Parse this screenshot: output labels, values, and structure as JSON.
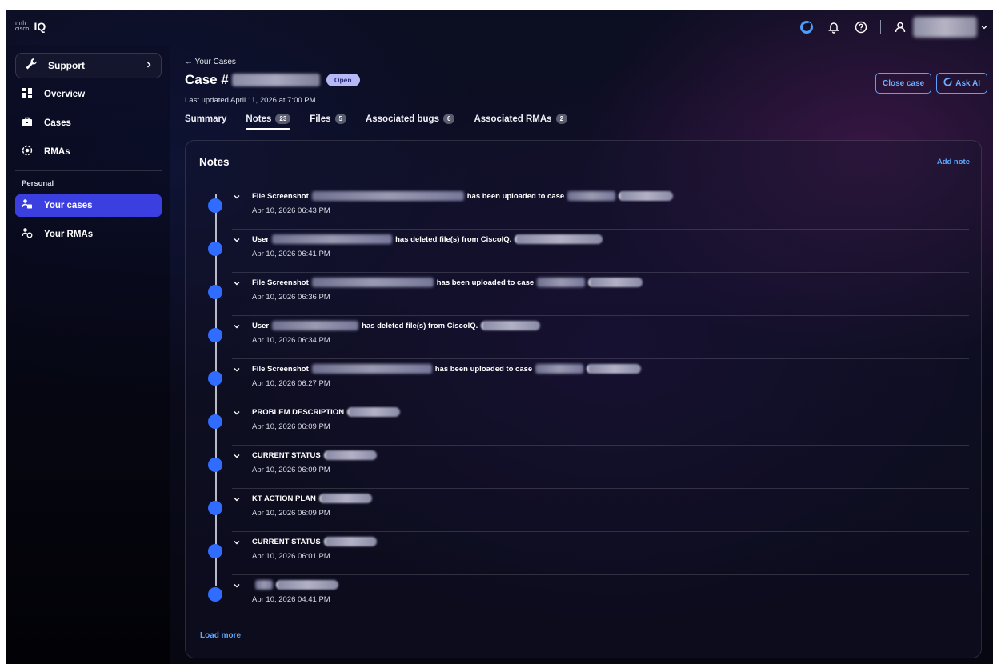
{
  "app": {
    "logo_small": "cisco",
    "logo_text": "IQ"
  },
  "sidebar": {
    "support_label": "Support",
    "items": [
      {
        "label": "Overview",
        "icon": "overview-icon"
      },
      {
        "label": "Cases",
        "icon": "briefcase-icon"
      },
      {
        "label": "RMAs",
        "icon": "rma-icon"
      }
    ],
    "personal_label": "Personal",
    "personal_items": [
      {
        "label": "Your cases",
        "icon": "user-case-icon",
        "active": true
      },
      {
        "label": "Your RMAs",
        "icon": "user-rma-icon",
        "active": false
      }
    ]
  },
  "header": {
    "back_label": "← Your Cases",
    "case_prefix": "Case #",
    "status": "Open",
    "updated": "Last updated April 11, 2026 at 7:00 PM",
    "close_case_label": "Close case",
    "ask_ai_label": "Ask AI"
  },
  "tabs": [
    {
      "label": "Summary",
      "count": ""
    },
    {
      "label": "Notes",
      "count": "23"
    },
    {
      "label": "Files",
      "count": "5"
    },
    {
      "label": "Associated bugs",
      "count": "6"
    },
    {
      "label": "Associated RMAs",
      "count": "2"
    }
  ],
  "notes_panel": {
    "title": "Notes",
    "add_note_label": "Add note",
    "load_more_label": "Load more",
    "notes": [
      {
        "t1": "File Screenshot",
        "t2": "has been uploaded to case",
        "date": "Apr 10, 2026 06:43 PM"
      },
      {
        "t1": "User",
        "t2": "has deleted file(s) from CiscoIQ.",
        "date": "Apr 10, 2026 06:41 PM"
      },
      {
        "t1": "File Screenshot",
        "t2": "has been uploaded to case",
        "date": "Apr 10, 2026 06:36 PM"
      },
      {
        "t1": "User",
        "t2": "has deleted file(s) from CiscoIQ.",
        "date": "Apr 10, 2026 06:34 PM"
      },
      {
        "t1": "File Screenshot",
        "t2": "has been uploaded to case",
        "date": "Apr 10, 2026 06:27 PM"
      },
      {
        "t1": "PROBLEM DESCRIPTION",
        "t2": "",
        "date": "Apr 10, 2026 06:09 PM"
      },
      {
        "t1": "CURRENT STATUS",
        "t2": "",
        "date": "Apr 10, 2026 06:09 PM"
      },
      {
        "t1": "KT ACTION PLAN",
        "t2": "",
        "date": "Apr 10, 2026 06:09 PM"
      },
      {
        "t1": "CURRENT STATUS",
        "t2": "",
        "date": "Apr 10, 2026 06:01 PM"
      },
      {
        "t1": "",
        "t2": "",
        "date": "Apr 10, 2026 04:41 PM"
      }
    ]
  },
  "colors": {
    "accent": "#2f6cff",
    "active_nav": "#3b3fe0",
    "link": "#5aa8ff"
  }
}
